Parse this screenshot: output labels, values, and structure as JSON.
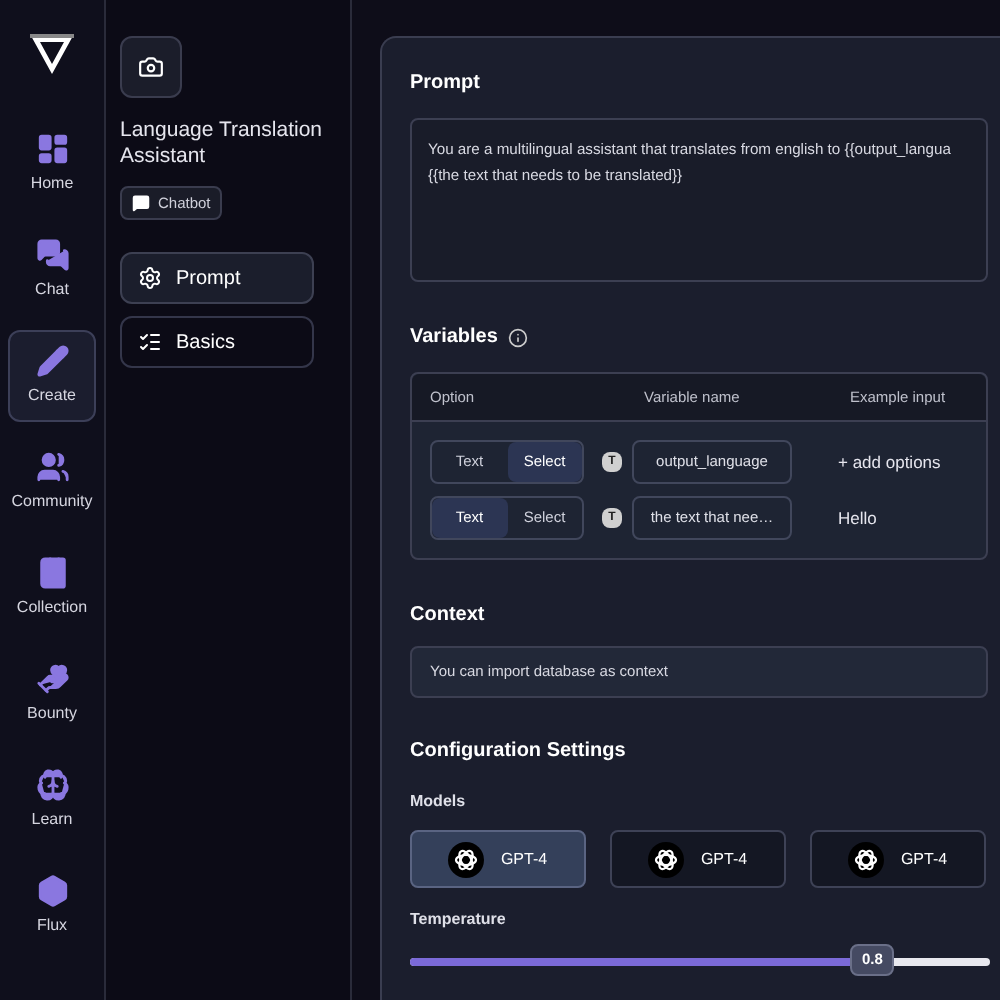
{
  "nav": [
    {
      "label": "Home",
      "selected": false
    },
    {
      "label": "Chat",
      "selected": false
    },
    {
      "label": "Create",
      "selected": true
    },
    {
      "label": "Community",
      "selected": false
    },
    {
      "label": "Collection",
      "selected": false
    },
    {
      "label": "Bounty",
      "selected": false
    },
    {
      "label": "Learn",
      "selected": false
    },
    {
      "label": "Flux",
      "selected": false
    }
  ],
  "assistant": {
    "name": "Language Translation Assistant",
    "badge": "Chatbot"
  },
  "sections": [
    {
      "label": "Prompt",
      "selected": true
    },
    {
      "label": "Basics",
      "selected": false
    }
  ],
  "prompt": {
    "title": "Prompt",
    "value": "You are a multilingual assistant that translates from english to {{output_langua\n{{the text that needs to be translated}}"
  },
  "variables": {
    "title": "Variables",
    "columns": [
      "Option",
      "Variable name",
      "Example input"
    ],
    "rows": [
      {
        "options": [
          {
            "label": "Text",
            "selected": false
          },
          {
            "label": "Select",
            "selected": true
          }
        ],
        "type_badge": "T",
        "name": "output_language",
        "example": "+ add options"
      },
      {
        "options": [
          {
            "label": "Text",
            "selected": true
          },
          {
            "label": "Select",
            "selected": false
          }
        ],
        "type_badge": "T",
        "name": "the text that nee…",
        "example": "Hello"
      }
    ]
  },
  "context": {
    "title": "Context",
    "value": "You can import database as context"
  },
  "configuration": {
    "title": "Configuration Settings",
    "models_label": "Models",
    "models": [
      {
        "label": "GPT-4",
        "selected": true
      },
      {
        "label": "GPT-4",
        "selected": false
      },
      {
        "label": "GPT-4",
        "selected": false
      }
    ],
    "temperature": {
      "label": "Temperature",
      "reading": "0.8",
      "level": 0.8
    }
  }
}
